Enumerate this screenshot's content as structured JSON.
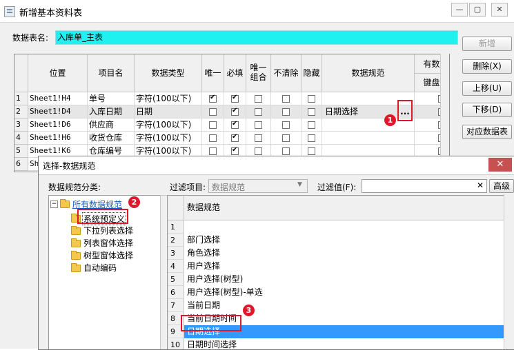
{
  "main": {
    "title": "新增基本资料表",
    "window_controls": {
      "minimize": "—",
      "restore": "▢",
      "close": "✕"
    },
    "table_name_label": "数据表名:",
    "table_name_value": "入库单_主表",
    "grid": {
      "columns": [
        "位置",
        "项目名",
        "数据类型",
        "唯一",
        "必填",
        "唯一\n组合",
        "不清除",
        "隐藏",
        "数据规范",
        "有数",
        "键盘"
      ],
      "rows": [
        {
          "num": "1",
          "position": "Sheet1!H4",
          "name": "单号",
          "type": "字符(100以下)",
          "unique": true,
          "required": true,
          "combo": false,
          "noclear": false,
          "hidden": false,
          "spec": ""
        },
        {
          "num": "2",
          "position": "Sheet1!D4",
          "name": "入库日期",
          "type": "日期",
          "unique": false,
          "required": true,
          "combo": false,
          "noclear": false,
          "hidden": false,
          "spec": "日期选择",
          "spec_button": "..."
        },
        {
          "num": "3",
          "position": "Sheet1!D6",
          "name": "供应商",
          "type": "字符(100以下)",
          "unique": false,
          "required": true,
          "combo": false,
          "noclear": false,
          "hidden": false,
          "spec": ""
        },
        {
          "num": "4",
          "position": "Sheet1!H6",
          "name": "收货仓库",
          "type": "字符(100以下)",
          "unique": false,
          "required": true,
          "combo": false,
          "noclear": false,
          "hidden": false,
          "spec": ""
        },
        {
          "num": "5",
          "position": "Sheet1!K6",
          "name": "仓库编号",
          "type": "字符(100以下)",
          "unique": false,
          "required": true,
          "combo": false,
          "noclear": false,
          "hidden": false,
          "spec": ""
        },
        {
          "num": "6",
          "position": "Sh",
          "name": "",
          "type": "",
          "unique": false,
          "required": false,
          "combo": false,
          "noclear": false,
          "hidden": false,
          "spec": ""
        }
      ]
    },
    "buttons": {
      "add": "新增",
      "delete": "删除(X)",
      "move_up": "上移(U)",
      "move_down": "下移(D)",
      "map_table": "对应数据表"
    }
  },
  "dialog": {
    "title": "选择-数据规范",
    "close": "✕",
    "category_label": "数据规范分类:",
    "filter_item_label": "过滤项目:",
    "filter_item_value": "数据规范",
    "filter_value_label": "过滤值(F):",
    "filter_value": "",
    "clear_icon": "✕",
    "advanced": "高级",
    "tree": {
      "root": "所有数据规范",
      "toggle": "−",
      "children": [
        "系统预定义",
        "下拉列表选择",
        "列表窗体选择",
        "树型窗体选择",
        "自动编码"
      ]
    },
    "list": {
      "header": "数据规范",
      "rows": [
        {
          "num": "1",
          "text": ""
        },
        {
          "num": "2",
          "text": "部门选择"
        },
        {
          "num": "3",
          "text": "角色选择"
        },
        {
          "num": "4",
          "text": "用户选择"
        },
        {
          "num": "5",
          "text": "用户选择(树型)"
        },
        {
          "num": "6",
          "text": "用户选择(树型)-单选"
        },
        {
          "num": "7",
          "text": "当前日期"
        },
        {
          "num": "8",
          "text": "当前日期时间"
        },
        {
          "num": "9",
          "text": "日期选择"
        },
        {
          "num": "10",
          "text": "日期时间选择"
        }
      ],
      "selected_row": "9"
    }
  },
  "callouts": [
    "1",
    "2",
    "3"
  ],
  "colors": {
    "accent_field": "#1ff0f0",
    "selection": "#3399ff",
    "callout": "#e0162b"
  }
}
